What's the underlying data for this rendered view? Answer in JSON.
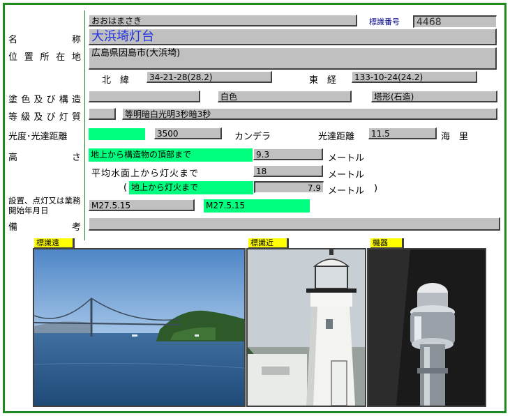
{
  "reading": "おおはまさき",
  "id_label": "標識番号",
  "id_value": "4468",
  "name_label": "名　　　　　称",
  "name_value": "大浜埼灯台",
  "location_label": "位置所在地",
  "location_value": "広島県因島市(大浜埼)",
  "lat_label": "北　緯",
  "lat_value": "34-21-28(28.2)",
  "lon_label": "東　経",
  "lon_value": "133-10-24(24.2)",
  "paint_label": "塗色及び構造",
  "paint_code": "",
  "paint_value": "白色",
  "structure_value": "塔形(石造)",
  "class_label": "等級及び灯質",
  "class_code": "",
  "class_value": "等明暗白光明3秒暗3秒",
  "intensity_label": "光度･光達距離",
  "intensity_code": "",
  "intensity_value": "3500",
  "candela_unit": "カンデラ",
  "range_label": "光達距離",
  "range_value": "11.5",
  "range_unit": "海　里",
  "height_label": "高　　　　　さ",
  "height1_label": "地上から構造物の頂部まで",
  "height1_value": "9.3",
  "height1_unit": "メートル",
  "height2_label": "平均水面上から灯火まで",
  "height2_value": "18",
  "height2_unit": "メートル",
  "height3_open": "(",
  "height3_label": "地上から灯火まで",
  "height3_value": "7.9",
  "height3_unit": "メートル",
  "height3_close": ")",
  "established_label": "設置、点灯又は業務開始年月日",
  "established_value1": "M27.5.15",
  "established_value2": "M27.5.15",
  "remarks_label": "備　　　　　考",
  "remarks_value": "",
  "photo_far_label": "標識遠",
  "photo_near_label": "標識近",
  "photo_equip_label": "機器"
}
